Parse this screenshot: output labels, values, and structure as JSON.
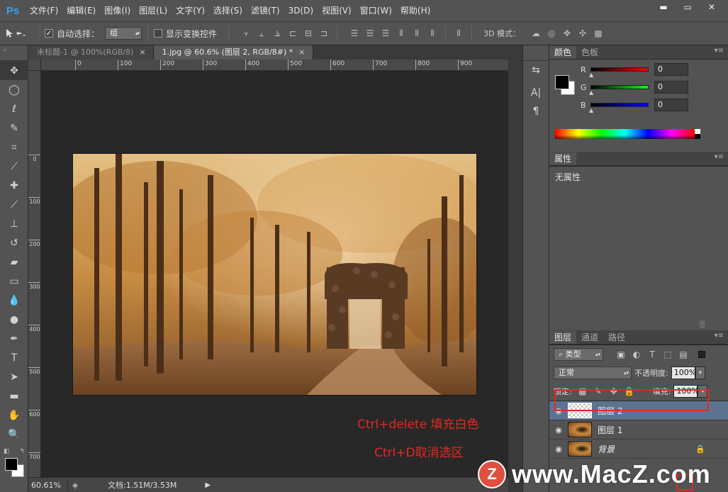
{
  "app": {
    "logo": "Ps"
  },
  "menubar": {
    "items": [
      "文件(F)",
      "编辑(E)",
      "图像(I)",
      "图层(L)",
      "文字(Y)",
      "选择(S)",
      "滤镜(T)",
      "3D(D)",
      "视图(V)",
      "窗口(W)",
      "帮助(H)"
    ]
  },
  "window_controls": {
    "minimize": "▬",
    "maximize": "▭",
    "close": "✕"
  },
  "options": {
    "auto_select_label": "自动选择：",
    "auto_select_checked": true,
    "group_value": "组",
    "transform_label": "显示变换控件",
    "mode3d_label": "3D 模式："
  },
  "doc_tabs": [
    {
      "label": "未标题-1 @ 100%(RGB/8)",
      "close": "×",
      "active": false
    },
    {
      "label": "1.jpg @ 60.6% (图层 2, RGB/8#) *",
      "close": "×",
      "active": true
    }
  ],
  "ruler_h": [
    "0",
    "100",
    "200",
    "300",
    "400",
    "500",
    "600",
    "700",
    "800",
    "900"
  ],
  "ruler_v": [
    "0",
    "100",
    "200",
    "300",
    "400",
    "500",
    "600",
    "700"
  ],
  "annotations": {
    "line1": "Ctrl+delete 填充白色",
    "line2": "Ctrl+D取消选区"
  },
  "status": {
    "zoom": "60.61%",
    "doc_info": "文档:1.51M/3.53M"
  },
  "color_panel": {
    "tabs": [
      "颜色",
      "色板"
    ],
    "channels": [
      {
        "label": "R",
        "value": "0",
        "gradient_end": "#ff0000"
      },
      {
        "label": "G",
        "value": "0",
        "gradient_end": "#00ff00"
      },
      {
        "label": "B",
        "value": "0",
        "gradient_end": "#0000ff"
      }
    ],
    "foreground": "#000000",
    "background": "#ffffff"
  },
  "properties_panel": {
    "tab": "属性",
    "content": "无属性"
  },
  "layers_panel": {
    "tabs": [
      "图层",
      "通道",
      "路径"
    ],
    "filter_kind": "类型",
    "blend_mode": "正常",
    "opacity_label": "不透明度:",
    "opacity_value": "100%",
    "lock_label": "锁定:",
    "fill_label": "填充:",
    "fill_value": "100%",
    "layers": [
      {
        "name": "图层 2",
        "selected": true,
        "thumb": "transparent"
      },
      {
        "name": "图层 1",
        "selected": false,
        "thumb": "photo"
      },
      {
        "name": "背景",
        "selected": false,
        "thumb": "photo",
        "locked": true
      }
    ]
  },
  "watermark": {
    "badge": "Z",
    "text": "www.MacZ.com"
  },
  "colors": {
    "annotation_red": "#e8271e",
    "selection_blue": "#5c7390",
    "ps_blue": "#2fa3f0"
  }
}
